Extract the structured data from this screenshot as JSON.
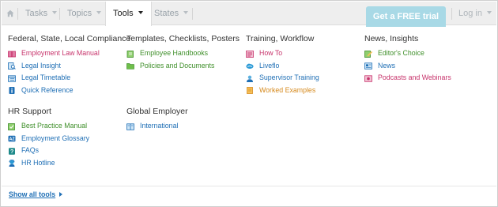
{
  "nav": {
    "tabs": [
      {
        "label": "Tasks"
      },
      {
        "label": "Topics"
      },
      {
        "label": "Tools"
      },
      {
        "label": "States"
      }
    ],
    "trial_button": "Get a FREE trial",
    "login": "Log in"
  },
  "menu": {
    "columns": [
      {
        "heading": "Federal, State, Local Compliance",
        "items": [
          {
            "label": "Employment Law Manual",
            "icon": "book-icon",
            "color": "#c7336b"
          },
          {
            "label": "Legal Insight",
            "icon": "search-doc-icon",
            "color": "#1f6fb5"
          },
          {
            "label": "Legal Timetable",
            "icon": "timetable-icon",
            "color": "#1f6fb5"
          },
          {
            "label": "Quick Reference",
            "icon": "info-icon",
            "color": "#1f6fb5"
          }
        ]
      },
      {
        "heading": "Templates, Checklists, Posters",
        "items": [
          {
            "label": "Employee Handbooks",
            "icon": "handbook-icon",
            "color": "#3f8f2a"
          },
          {
            "label": "Policies and Documents",
            "icon": "folder-icon",
            "color": "#3f8f2a"
          }
        ]
      },
      {
        "heading": "Training, Workflow",
        "items": [
          {
            "label": "How To",
            "icon": "list-icon",
            "color": "#c7336b"
          },
          {
            "label": "Liveflo",
            "icon": "cloud-icon",
            "color": "#1f6fb5"
          },
          {
            "label": "Supervisor Training",
            "icon": "supervisor-icon",
            "color": "#1f6fb5"
          },
          {
            "label": "Worked Examples",
            "icon": "notes-icon",
            "color": "#d68a1e"
          }
        ]
      },
      {
        "heading": "News, Insights",
        "items": [
          {
            "label": "Editor's Choice",
            "icon": "pencil-doc-icon",
            "color": "#3f8f2a"
          },
          {
            "label": "News",
            "icon": "news-icon",
            "color": "#1f6fb5"
          },
          {
            "label": "Podcasts and Webinars",
            "icon": "podcast-icon",
            "color": "#c7336b"
          }
        ]
      },
      {
        "heading": "HR Support",
        "items": [
          {
            "label": "Best Practice Manual",
            "icon": "best-practice-icon",
            "color": "#3f8f2a"
          },
          {
            "label": "Employment Glossary",
            "icon": "glossary-icon",
            "color": "#1f6fb5"
          },
          {
            "label": "FAQs",
            "icon": "faq-icon",
            "color": "#1f6fb5"
          },
          {
            "label": "HR Hotline",
            "icon": "hotline-icon",
            "color": "#1f6fb5"
          }
        ]
      },
      {
        "heading": "Global Employer",
        "items": [
          {
            "label": "International",
            "icon": "globe-book-icon",
            "color": "#1f6fb5"
          }
        ]
      }
    ]
  },
  "show_all": "Show all tools"
}
